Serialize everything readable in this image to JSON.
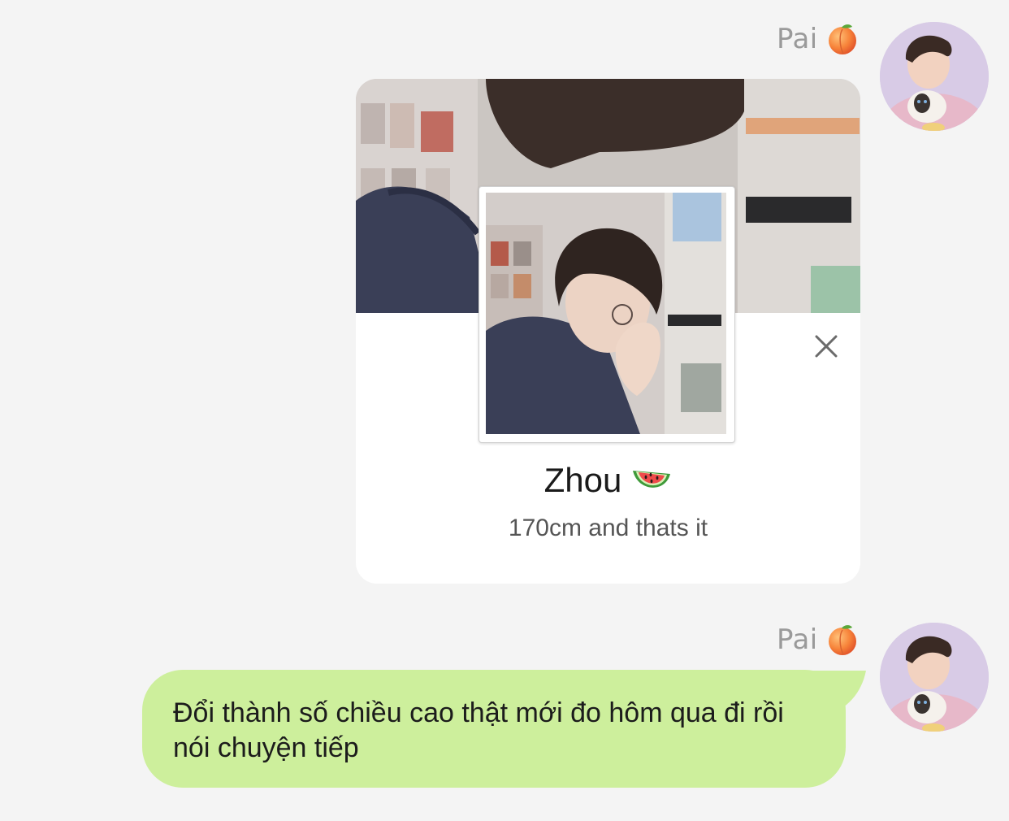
{
  "messages": [
    {
      "sender": "Pai",
      "sender_emoji_icon": "peach-icon",
      "type": "profile-card",
      "card": {
        "name": "Zhou",
        "name_emoji_icon": "watermelon-icon",
        "status": "170cm and thats it",
        "close_icon": "close-icon"
      }
    },
    {
      "sender": "Pai",
      "sender_emoji_icon": "peach-icon",
      "type": "text",
      "text": "Đổi thành số chiều cao thật mới đo hôm qua đi rồi nói chuyện tiếp"
    }
  ],
  "colors": {
    "background": "#f4f4f4",
    "bubble": "#cdef9c",
    "card": "#ffffff",
    "sender_name": "#9a9a9a"
  }
}
